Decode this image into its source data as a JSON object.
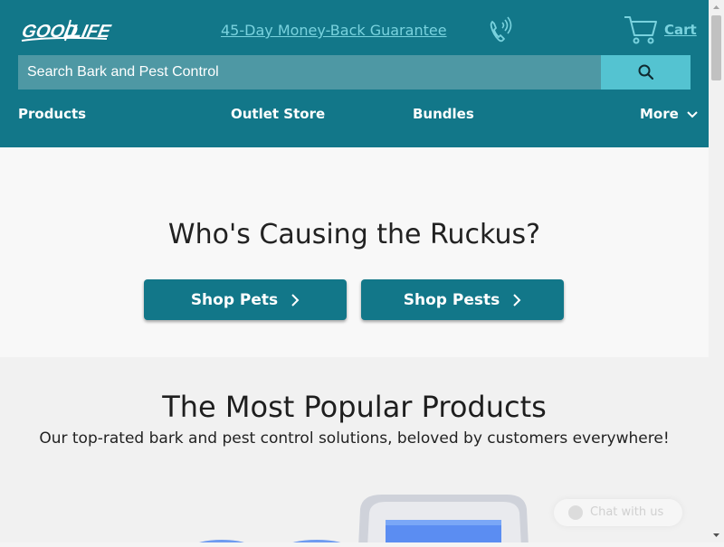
{
  "header": {
    "logo_text": "GOOD LIFE",
    "guarantee_link": "45-Day Money-Back Guarantee",
    "phone_icon": "phone-icon",
    "cart_label": "Cart",
    "cart_icon": "cart-icon"
  },
  "search": {
    "placeholder": "Search Bark and Pest Control",
    "button_icon": "search-icon"
  },
  "nav": {
    "items": [
      "Products",
      "Outlet Store",
      "Bundles",
      "More"
    ]
  },
  "hero": {
    "title": "Who's Causing the Ruckus?",
    "buttons": [
      "Shop Pets",
      "Shop Pests"
    ]
  },
  "popular": {
    "title": "The Most Popular Products",
    "subtitle": "Our top-rated bark and pest control solutions, beloved by customers everywhere!"
  },
  "chat": {
    "label": "Chat with us"
  },
  "colors": {
    "header_bg": "#127789",
    "accent_light": "#79d2de",
    "search_field": "#4e98a4",
    "search_button": "#54c3d1",
    "button_bg": "#127789"
  }
}
